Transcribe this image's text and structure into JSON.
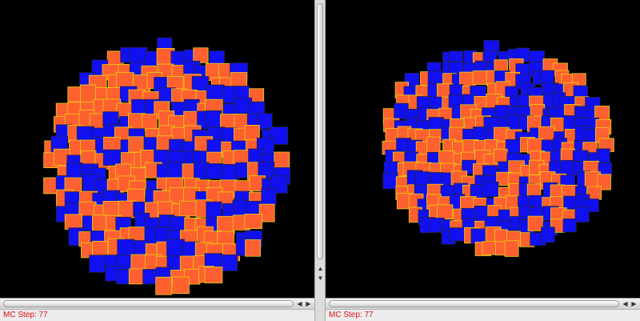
{
  "panes": [
    {
      "status_text": "MC Step: 77",
      "scroll_left_glyph": "◀",
      "scroll_right_glyph": "▶"
    },
    {
      "status_text": "MC Step: 77",
      "scroll_left_glyph": "◀",
      "scroll_right_glyph": "▶"
    }
  ],
  "splitter": {
    "up_glyph": "▲",
    "down_glyph": "▼"
  },
  "colors": {
    "background": "#000000",
    "cell_type_a": "#1010f0",
    "cell_type_b": "#ff6030",
    "membrane_a": "#222244",
    "membrane_b": "#e8d010",
    "status_text": "#e01010"
  }
}
